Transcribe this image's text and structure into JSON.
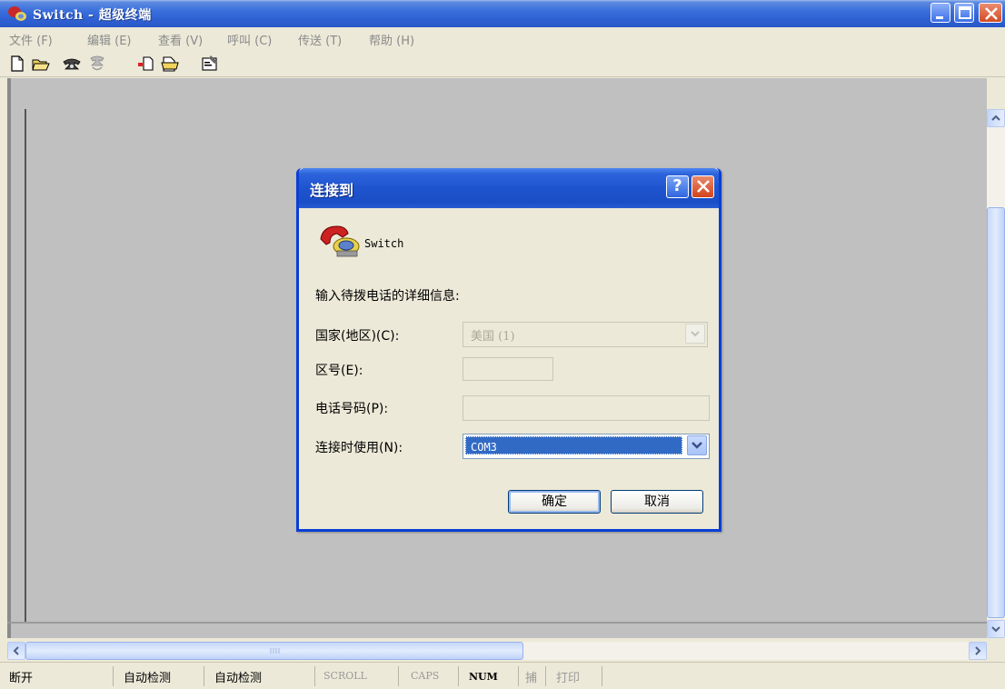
{
  "window": {
    "title": "Switch - 超级终端"
  },
  "menu": {
    "items": [
      "文件 (F)",
      "编辑 (E)",
      "查看 (V)",
      "呼叫 (C)",
      "传送 (T)",
      "帮助 (H)"
    ]
  },
  "toolbar": {
    "icons": [
      "new-icon",
      "open-icon",
      "call-icon",
      "disconnect-icon",
      "send-icon",
      "receive-icon",
      "properties-icon"
    ]
  },
  "dialog": {
    "title": "连接到",
    "help_label": "?",
    "connection_name": "Switch",
    "prompt": "输入待拨电话的详细信息:",
    "country_label": "国家(地区)(C):",
    "country_value": "美国 (1)",
    "area_code_label": "区号(E):",
    "area_code_value": "",
    "phone_label": "电话号码(P):",
    "phone_value": "",
    "connect_using_label": "连接时使用(N):",
    "connect_using_value": "COM3",
    "ok_label": "确定",
    "cancel_label": "取消"
  },
  "statusbar": {
    "connection_state": "断开",
    "auto_detect_1": "自动检测",
    "auto_detect_2": "自动检测",
    "scroll": "SCROLL",
    "caps": "CAPS",
    "num": "NUM",
    "capture": "捕",
    "print": "打印"
  },
  "colors": {
    "titlebar": "#2f61d3",
    "client_background": "#c0c0c0",
    "selection": "#316ac5"
  }
}
